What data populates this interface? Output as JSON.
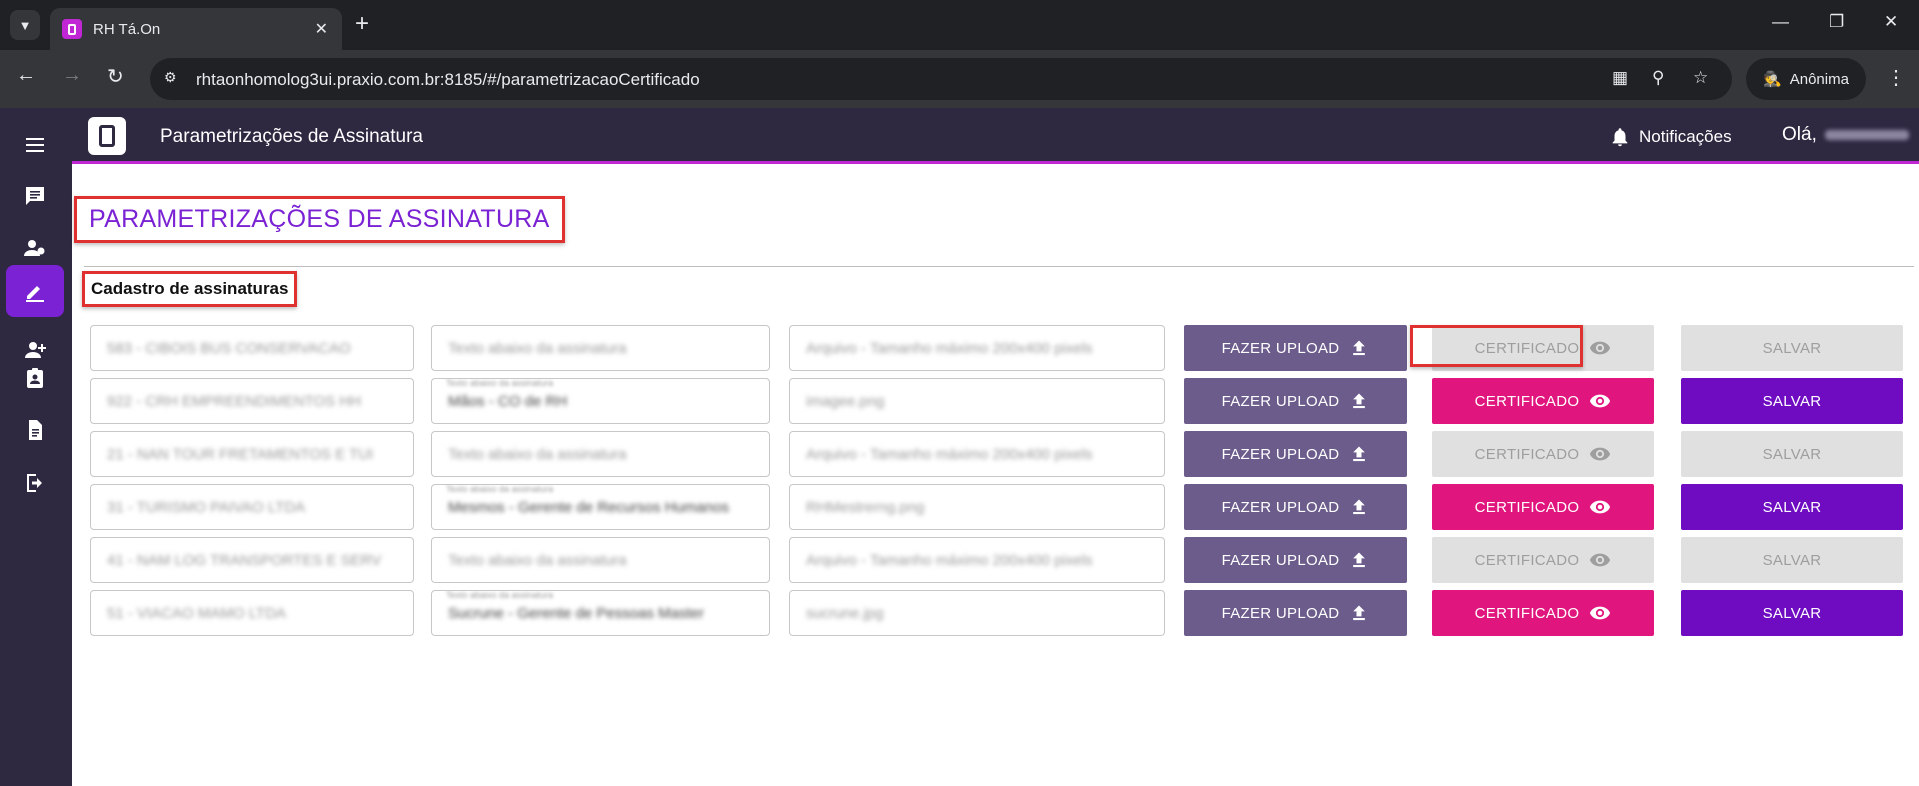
{
  "browser": {
    "tab_title": "RH Tá.On",
    "url": "rhtaonhomolog3ui.praxio.com.br:8185/#/parametrizacaoCertificado",
    "profile_label": "Anônima"
  },
  "header": {
    "title": "Parametrizações de Assinatura",
    "notifications_label": "Notificações",
    "greeting": "Olá,"
  },
  "page": {
    "title": "PARAMETRIZAÇÕES DE ASSINATURA",
    "section_title": "Cadastro de assinaturas"
  },
  "buttons": {
    "upload": "FAZER UPLOAD",
    "certificate": "CERTIFICADO",
    "save": "SALVAR"
  },
  "rows": [
    {
      "company": "583 - CIBOIS BUS CONSERVACAO",
      "text_label": "",
      "text": "Texto abaixo da assinatura",
      "file": "Arquivo - Tamanho máximo 200x400 pixels",
      "enabled": false
    },
    {
      "company": "922 - CRH EMPREENDIMENTOS HH",
      "text_label": "Texto abaixo da assinatura",
      "text": "Mãos - CO de RH",
      "file": "imagee.png",
      "enabled": true
    },
    {
      "company": "21 - NAN TOUR FRETAMENTOS E TUI",
      "text_label": "",
      "text": "Texto abaixo da assinatura",
      "file": "Arquivo - Tamanho máximo 200x400 pixels",
      "enabled": false
    },
    {
      "company": "31 - TURISMO PAIVAO LTDA",
      "text_label": "Texto abaixo da assinatura",
      "text": "Mesmos - Gerente de Recursos Humanos",
      "file": "RHMestrerng.png",
      "enabled": true
    },
    {
      "company": "41 - NAM LOG TRANSPORTES E SERV",
      "text_label": "",
      "text": "Texto abaixo da assinatura",
      "file": "Arquivo - Tamanho máximo 200x400 pixels",
      "enabled": false
    },
    {
      "company": "51 - VIACAO MAMO LTDA",
      "text_label": "Texto abaixo da assinatura",
      "text": "Sucrune - Gerente de Pessoas Master",
      "file": "sucrune.jpg",
      "enabled": true
    }
  ]
}
